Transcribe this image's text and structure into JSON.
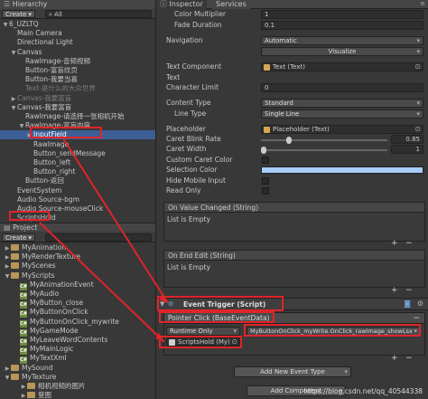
{
  "hierarchy": {
    "tab": "Hierarchy",
    "create": "Create",
    "search": "All",
    "items": [
      {
        "label": "6_UZLTQ",
        "arrow": "▼"
      },
      {
        "label": "Main Camera",
        "arrow": ""
      },
      {
        "label": "Directional Light",
        "arrow": ""
      },
      {
        "label": "Canvas",
        "arrow": "▼"
      },
      {
        "label": "RawImage-音频视频",
        "arrow": ""
      },
      {
        "label": "Button-富盲纹页",
        "arrow": ""
      },
      {
        "label": "Button-我要当喜",
        "arrow": ""
      },
      {
        "label": "Text-是什么的大众世界",
        "arrow": ""
      },
      {
        "label": "Canvas-我要富盲",
        "arrow": "▶"
      },
      {
        "label": "Canvas-我要富盲",
        "arrow": "▼"
      },
      {
        "label": "RawImage-请选择一张相机开始",
        "arrow": ""
      },
      {
        "label": "RawImage-富盲内容",
        "arrow": "▼"
      },
      {
        "label": "InputField",
        "arrow": "▶"
      },
      {
        "label": "RawImage",
        "arrow": ""
      },
      {
        "label": "Button_sendMessage",
        "arrow": ""
      },
      {
        "label": "Button_left",
        "arrow": ""
      },
      {
        "label": "Button_right",
        "arrow": ""
      },
      {
        "label": "Button-返回",
        "arrow": ""
      },
      {
        "label": "EventSystem",
        "arrow": ""
      },
      {
        "label": "Audio Source-bgm",
        "arrow": ""
      },
      {
        "label": "Audio Source-mouseClick",
        "arrow": ""
      },
      {
        "label": "ScriptsHold",
        "arrow": ""
      }
    ]
  },
  "project": {
    "tab": "Project",
    "create": "Create",
    "items": [
      {
        "label": "MyAnimation",
        "type": "folder"
      },
      {
        "label": "MyRenderTexture",
        "type": "folder"
      },
      {
        "label": "MyScenes",
        "type": "folder"
      },
      {
        "label": "MyScripts",
        "type": "folder"
      },
      {
        "label": "MyAnimationEvent",
        "type": "script"
      },
      {
        "label": "MyAudio",
        "type": "script"
      },
      {
        "label": "MyButton_close",
        "type": "script"
      },
      {
        "label": "MyButtonOnClick",
        "type": "script"
      },
      {
        "label": "MyButtonOnClick_mywrite",
        "type": "script"
      },
      {
        "label": "MyGameMode",
        "type": "script"
      },
      {
        "label": "MyLeaveWordContents",
        "type": "script"
      },
      {
        "label": "MyMainLogic",
        "type": "script"
      },
      {
        "label": "MyTextXml",
        "type": "script"
      },
      {
        "label": "MySound",
        "type": "folder"
      },
      {
        "label": "MyTexture",
        "type": "folder"
      },
      {
        "label": "相机视频的图片",
        "type": "folder"
      },
      {
        "label": "登图",
        "type": "folder"
      }
    ]
  },
  "inspector": {
    "tabs": [
      "Inspector",
      "Services"
    ],
    "color_multiplier": {
      "label": "Color Multiplier",
      "value": "1"
    },
    "fade_duration": {
      "label": "Fade Duration",
      "value": "0.1"
    },
    "navigation": {
      "label": "Navigation",
      "value": "Automatic"
    },
    "visualize": "Visualize",
    "text_component": {
      "label": "Text Component",
      "value": "Text (Text)"
    },
    "text": {
      "label": "Text",
      "value": ""
    },
    "character_limit": {
      "label": "Character Limit",
      "value": "0"
    },
    "content_type": {
      "label": "Content Type",
      "value": "Standard"
    },
    "line_type": {
      "label": "Line Type",
      "value": "Single Line"
    },
    "placeholder": {
      "label": "Placeholder",
      "value": "Placeholder (Text)"
    },
    "caret_blink_rate": {
      "label": "Caret Blink Rate",
      "value": "0.85",
      "fraction": 0.21
    },
    "caret_width": {
      "label": "Caret Width",
      "value": "1",
      "fraction": 0.0
    },
    "custom_caret_color": {
      "label": "Custom Caret Color"
    },
    "selection_color": {
      "label": "Selection Color",
      "color": "#a8cef8"
    },
    "hide_mobile_input": {
      "label": "Hide Mobile Input"
    },
    "read_only": {
      "label": "Read Only"
    },
    "on_value_changed": {
      "header": "On Value Changed (String)",
      "body": "List is Empty"
    },
    "on_end_edit": {
      "header": "On End Edit (String)",
      "body": "List is Empty"
    },
    "event_trigger": {
      "title": "Event Trigger (Script)",
      "entry": "Pointer Click (BaseEventData)",
      "runtime": "Runtime Only",
      "function": "MyButtonOnClick_myWrite.OnClick_rawImage_showLsx",
      "object": "ScriptsHold (My)"
    },
    "add_event_type": "Add New Event Type",
    "add_component": "Add Component"
  },
  "watermark": "https://blog.csdn.net/qq_40544338",
  "colors": {
    "selection": "#3e5f96",
    "highlight_red": "#e0242a",
    "panel_bg": "#383838",
    "field_bg": "#2e2e2e"
  }
}
